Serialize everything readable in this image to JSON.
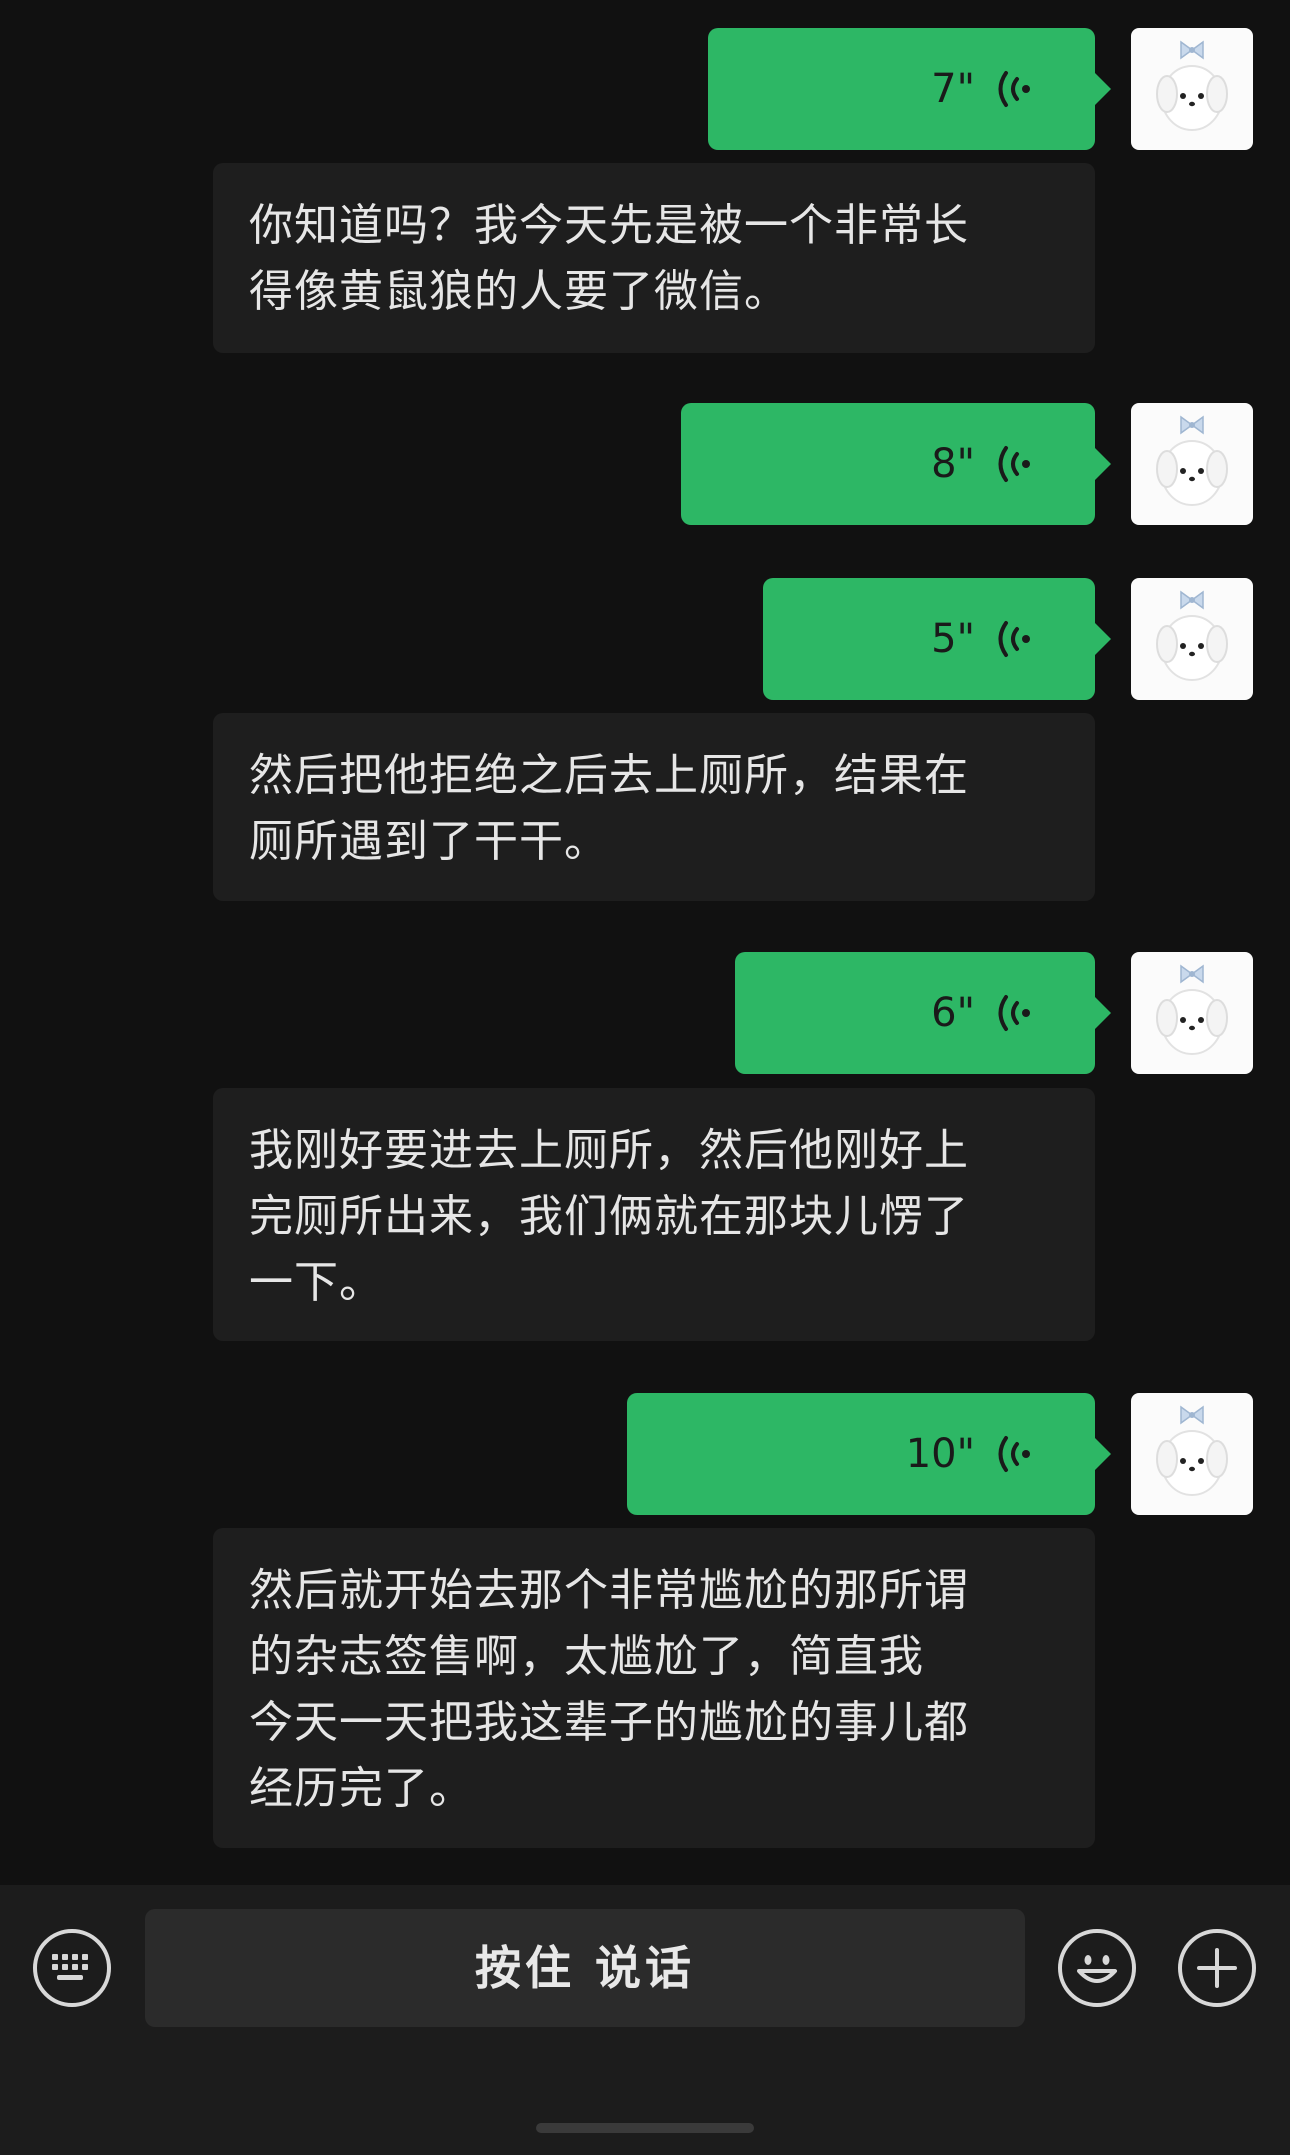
{
  "messages": [
    {
      "duration": "7\"",
      "transcript": [
        "你知道吗？我今天先是被一个非常长",
        "得像黄鼠狼的人要了微信。"
      ]
    },
    {
      "duration": "8\"",
      "transcript": []
    },
    {
      "duration": "5\"",
      "transcript": [
        "然后把他拒绝之后去上厕所，结果在",
        "厕所遇到了干干。"
      ]
    },
    {
      "duration": "6\"",
      "transcript": [
        "我刚好要进去上厕所，然后他刚好上",
        "完厕所出来，我们俩就在那块儿愣了",
        "一下。"
      ]
    },
    {
      "duration": "10\"",
      "transcript": [
        "然后就开始去那个非常尴尬的那所谓",
        "的杂志签售啊，太尴尬了，简直我",
        "今天一天把我这辈子的尴尬的事儿都",
        "经历完了。"
      ]
    }
  ],
  "input_bar": {
    "talk_label": "按住 说话",
    "left_icon": "keyboard-icon",
    "emoji_icon": "emoji-icon",
    "plus_icon": "plus-icon"
  },
  "colors": {
    "background": "#111111",
    "bubble_green": "#2DB765",
    "transcript_bg": "#1e1e1e",
    "input_bar_bg": "#1c1c1c"
  }
}
